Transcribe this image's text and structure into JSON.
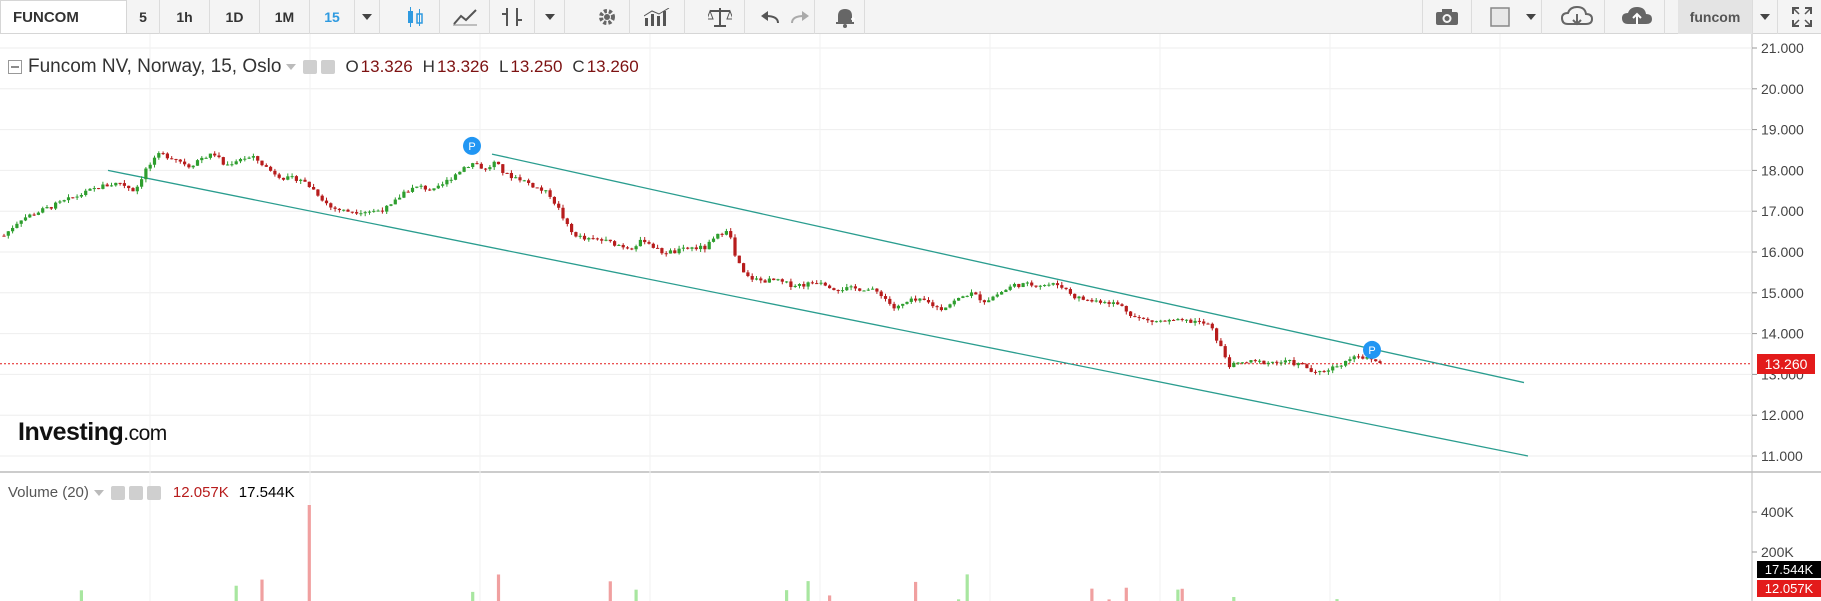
{
  "toolbar": {
    "symbol": "FUNCOM",
    "intervals": [
      "5",
      "1h",
      "1D",
      "1M",
      "15"
    ],
    "active_interval": "15",
    "user_label": "funcom"
  },
  "legend": {
    "title": "Funcom NV, Norway, 15, Oslo",
    "open_label": "O",
    "open": "13.326",
    "high_label": "H",
    "high": "13.326",
    "low_label": "L",
    "low": "13.250",
    "close_label": "C",
    "close": "13.260"
  },
  "volume_legend": {
    "title": "Volume (20)",
    "value1": "12.057K",
    "value2": "17.544K"
  },
  "logo": {
    "brand": "Investing",
    "suffix": ".com"
  },
  "price_tag": "13.260",
  "volume_tags": {
    "top": "17.544K",
    "bottom": "12.057K"
  },
  "colors": {
    "up": "#2e9e2e",
    "down": "#b71c1c",
    "channel": "#2a9d8f",
    "price_line": "#e31b1b",
    "marker": "#2196f3"
  },
  "chart_data": {
    "type": "candlestick",
    "y_axis_ticks": [
      "21.000",
      "20.000",
      "19.000",
      "18.000",
      "17.000",
      "16.000",
      "15.000",
      "14.000",
      "13.000",
      "12.000",
      "11.000"
    ],
    "ylim": [
      11.0,
      21.0
    ],
    "volume_axis_ticks": [
      "400K",
      "200K"
    ],
    "close_path": [
      [
        0,
        16.3
      ],
      [
        20,
        16.8
      ],
      [
        40,
        17.0
      ],
      [
        60,
        17.2
      ],
      [
        80,
        17.4
      ],
      [
        100,
        17.6
      ],
      [
        120,
        17.7
      ],
      [
        135,
        17.5
      ],
      [
        145,
        18.0
      ],
      [
        160,
        18.4
      ],
      [
        175,
        18.3
      ],
      [
        190,
        18.1
      ],
      [
        200,
        18.3
      ],
      [
        215,
        18.4
      ],
      [
        225,
        18.1
      ],
      [
        240,
        18.3
      ],
      [
        255,
        18.3
      ],
      [
        270,
        18.0
      ],
      [
        285,
        17.8
      ],
      [
        300,
        17.8
      ],
      [
        315,
        17.5
      ],
      [
        330,
        17.1
      ],
      [
        345,
        17.0
      ],
      [
        360,
        17.0
      ],
      [
        375,
        17.0
      ],
      [
        390,
        17.1
      ],
      [
        405,
        17.5
      ],
      [
        420,
        17.6
      ],
      [
        435,
        17.5
      ],
      [
        450,
        17.8
      ],
      [
        465,
        18.1
      ],
      [
        475,
        18.2
      ],
      [
        485,
        18.0
      ],
      [
        495,
        18.2
      ],
      [
        505,
        17.9
      ],
      [
        520,
        17.8
      ],
      [
        535,
        17.6
      ],
      [
        550,
        17.4
      ],
      [
        560,
        17.0
      ],
      [
        570,
        16.5
      ],
      [
        585,
        16.3
      ],
      [
        600,
        16.3
      ],
      [
        615,
        16.2
      ],
      [
        630,
        16.1
      ],
      [
        645,
        16.3
      ],
      [
        660,
        16.0
      ],
      [
        675,
        16.0
      ],
      [
        690,
        16.1
      ],
      [
        705,
        16.1
      ],
      [
        718,
        16.4
      ],
      [
        728,
        16.6
      ],
      [
        735,
        15.9
      ],
      [
        745,
        15.4
      ],
      [
        760,
        15.3
      ],
      [
        775,
        15.3
      ],
      [
        790,
        15.2
      ],
      [
        805,
        15.2
      ],
      [
        820,
        15.3
      ],
      [
        835,
        15.1
      ],
      [
        850,
        15.1
      ],
      [
        865,
        15.1
      ],
      [
        880,
        15.0
      ],
      [
        895,
        14.6
      ],
      [
        910,
        14.8
      ],
      [
        925,
        14.8
      ],
      [
        940,
        14.6
      ],
      [
        955,
        14.8
      ],
      [
        970,
        15.0
      ],
      [
        985,
        14.8
      ],
      [
        1000,
        15.0
      ],
      [
        1015,
        15.2
      ],
      [
        1030,
        15.2
      ],
      [
        1045,
        15.2
      ],
      [
        1060,
        15.2
      ],
      [
        1075,
        14.9
      ],
      [
        1090,
        14.8
      ],
      [
        1105,
        14.8
      ],
      [
        1120,
        14.7
      ],
      [
        1135,
        14.4
      ],
      [
        1150,
        14.3
      ],
      [
        1165,
        14.3
      ],
      [
        1180,
        14.3
      ],
      [
        1195,
        14.3
      ],
      [
        1210,
        14.2
      ],
      [
        1220,
        13.7
      ],
      [
        1230,
        13.2
      ],
      [
        1245,
        13.3
      ],
      [
        1260,
        13.3
      ],
      [
        1275,
        13.3
      ],
      [
        1290,
        13.3
      ],
      [
        1305,
        13.2
      ],
      [
        1315,
        13.0
      ],
      [
        1325,
        13.1
      ],
      [
        1335,
        13.2
      ],
      [
        1345,
        13.3
      ],
      [
        1355,
        13.5
      ],
      [
        1365,
        13.4
      ],
      [
        1380,
        13.3
      ]
    ],
    "channel_lines": [
      {
        "x1": 108,
        "y1": 18.0,
        "x2": 1528,
        "y2": 11.0
      },
      {
        "x1": 492,
        "y1": 18.4,
        "x2": 1524,
        "y2": 12.8
      }
    ],
    "markers": [
      {
        "x": 472,
        "y": 18.6,
        "label": "P"
      },
      {
        "x": 1372,
        "y": 13.6,
        "label": "P"
      }
    ],
    "last_price": 13.26
  }
}
